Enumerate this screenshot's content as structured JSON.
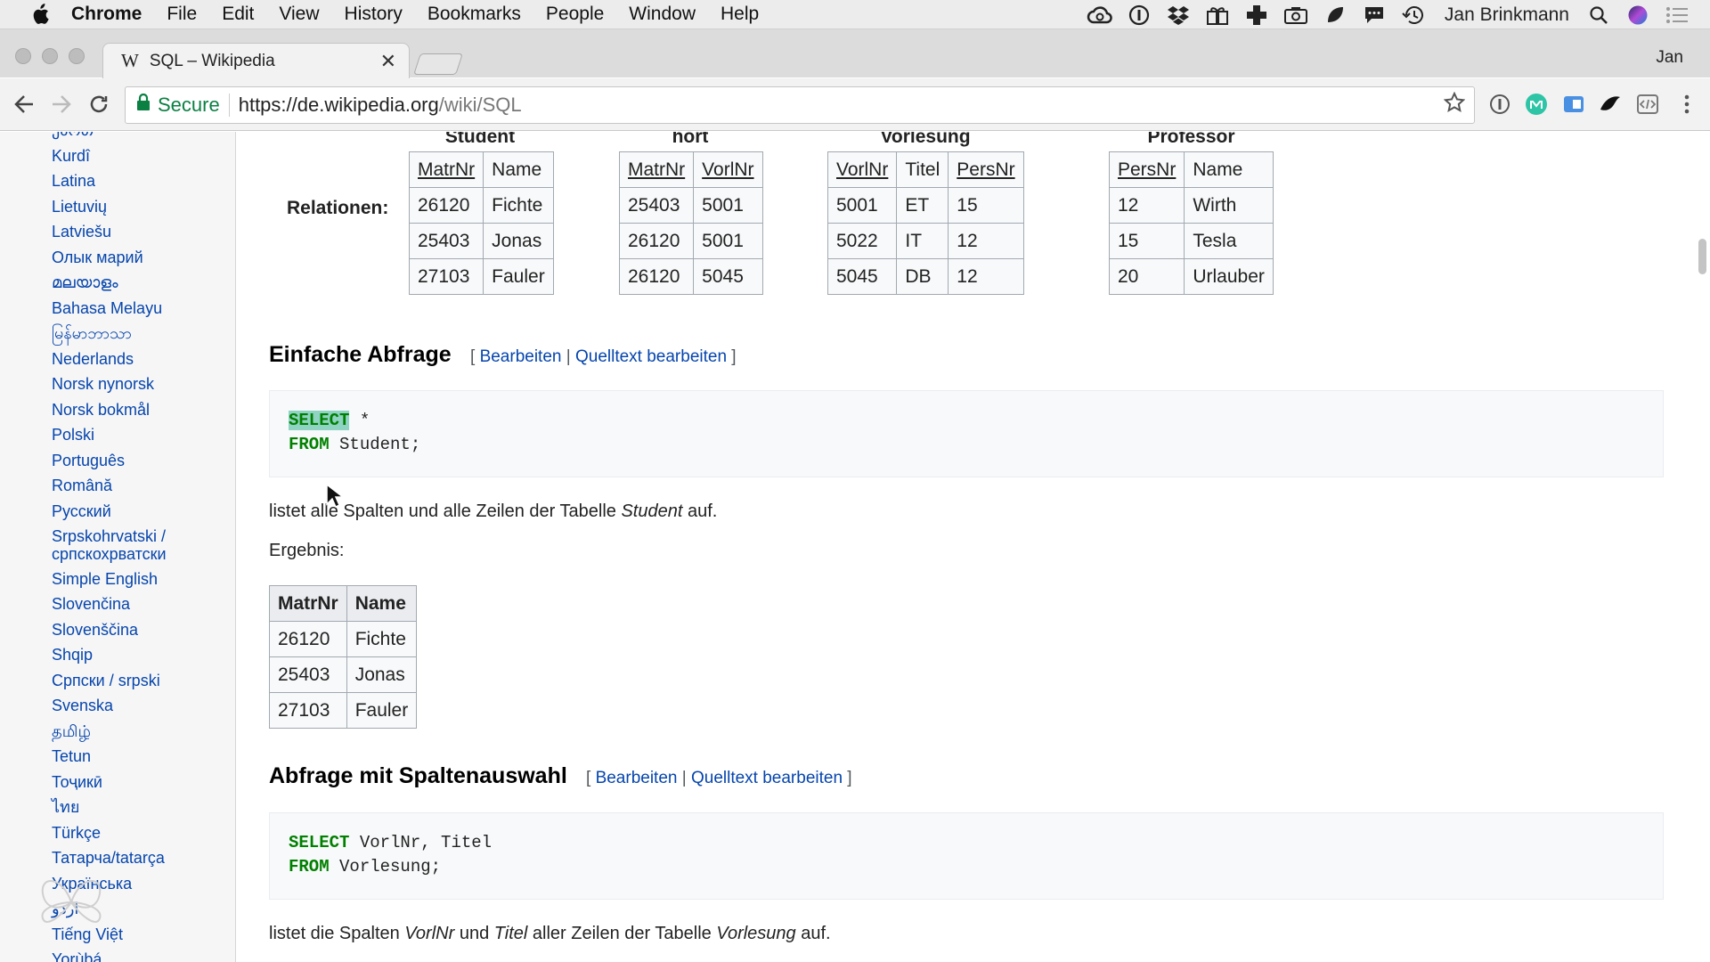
{
  "menubar": {
    "app": "Chrome",
    "items": [
      "File",
      "Edit",
      "View",
      "History",
      "Bookmarks",
      "People",
      "Window",
      "Help"
    ],
    "user": "Jan Brinkmann"
  },
  "browser": {
    "tab_favicon": "W",
    "tab_title": "SQL – Wikipedia",
    "profile_label": "Jan",
    "secure_label": "Secure",
    "url_host": "https://de.wikipedia.org",
    "url_path": "/wiki/SQL",
    "secure_color": "#0b8043"
  },
  "sidebar": {
    "items": [
      "ქართ",
      "Kurdî",
      "Latina",
      "Lietuvių",
      "Latviešu",
      "Олык марий",
      "മലയാളം",
      "Bahasa Melayu",
      "မြန်မာဘာသာ",
      "Nederlands",
      "Norsk nynorsk",
      "Norsk bokmål",
      "Polski",
      "Português",
      "Română",
      "Русский",
      "Srpskohrvatski / српскохрватски",
      "Simple English",
      "Slovenčina",
      "Slovenščina",
      "Shqip",
      "Српски / srpski",
      "Svenska",
      "தமிழ்",
      "Tetun",
      "Тоҷикӣ",
      "ไทย",
      "Türkçe",
      "Татарча/tatarça",
      "Українська",
      "اردو",
      "Tiếng Việt",
      "Yorùbá"
    ]
  },
  "relations": {
    "label": "Relationen:",
    "tables": [
      {
        "caption": "Student",
        "headers": [
          "MatrNr",
          "Name"
        ],
        "underlined": [
          true,
          false
        ],
        "rows": [
          [
            "26120",
            "Fichte"
          ],
          [
            "25403",
            "Jonas"
          ],
          [
            "27103",
            "Fauler"
          ]
        ]
      },
      {
        "caption": "hört",
        "headers": [
          "MatrNr",
          "VorlNr"
        ],
        "underlined": [
          true,
          true
        ],
        "rows": [
          [
            "25403",
            "5001"
          ],
          [
            "26120",
            "5001"
          ],
          [
            "26120",
            "5045"
          ]
        ]
      },
      {
        "caption": "Vorlesung",
        "headers": [
          "VorlNr",
          "Titel",
          "PersNr"
        ],
        "underlined": [
          true,
          false,
          true
        ],
        "rows": [
          [
            "5001",
            "ET",
            "15"
          ],
          [
            "5022",
            "IT",
            "12"
          ],
          [
            "5045",
            "DB",
            "12"
          ]
        ]
      },
      {
        "caption": "Professor",
        "headers": [
          "PersNr",
          "Name"
        ],
        "underlined": [
          true,
          false
        ],
        "rows": [
          [
            "12",
            "Wirth"
          ],
          [
            "15",
            "Tesla"
          ],
          [
            "20",
            "Urlauber"
          ]
        ]
      }
    ]
  },
  "section1": {
    "title": "Einfache Abfrage",
    "edit": "Bearbeiten",
    "source_edit": "Quelltext bearbeiten",
    "code": [
      {
        "kw": "SELECT",
        "rest": " *"
      },
      {
        "kw": "FROM",
        "rest": " Student;"
      }
    ],
    "desc_pre": "listet alle Spalten und alle Zeilen der Tabelle ",
    "desc_em": "Student",
    "desc_post": " auf.",
    "result_label": "Ergebnis:",
    "result": {
      "headers": [
        "MatrNr",
        "Name"
      ],
      "rows": [
        [
          "26120",
          "Fichte"
        ],
        [
          "25403",
          "Jonas"
        ],
        [
          "27103",
          "Fauler"
        ]
      ]
    }
  },
  "section2": {
    "title": "Abfrage mit Spaltenauswahl",
    "edit": "Bearbeiten",
    "source_edit": "Quelltext bearbeiten",
    "code": [
      {
        "kw": "SELECT",
        "rest": " VorlNr, Titel"
      },
      {
        "kw": "FROM",
        "rest": " Vorlesung;"
      }
    ],
    "desc_a": "listet die Spalten ",
    "desc_em1": "VorlNr",
    "desc_b": " und ",
    "desc_em2": "Titel",
    "desc_c": " aller Zeilen der Tabelle ",
    "desc_em3": "Vorlesung",
    "desc_d": " auf."
  },
  "icons": [
    "apple-icon",
    "creative-cloud-icon",
    "1password-icon",
    "dropbox-icon",
    "gift-icon",
    "plus-icon",
    "camera-icon",
    "leaf-icon",
    "chat-icon",
    "time-machine-icon",
    "search-icon",
    "siri-icon",
    "notification-icon",
    "back-icon",
    "forward-icon",
    "reload-icon",
    "lock-icon",
    "star-icon",
    "kebab-icon"
  ]
}
